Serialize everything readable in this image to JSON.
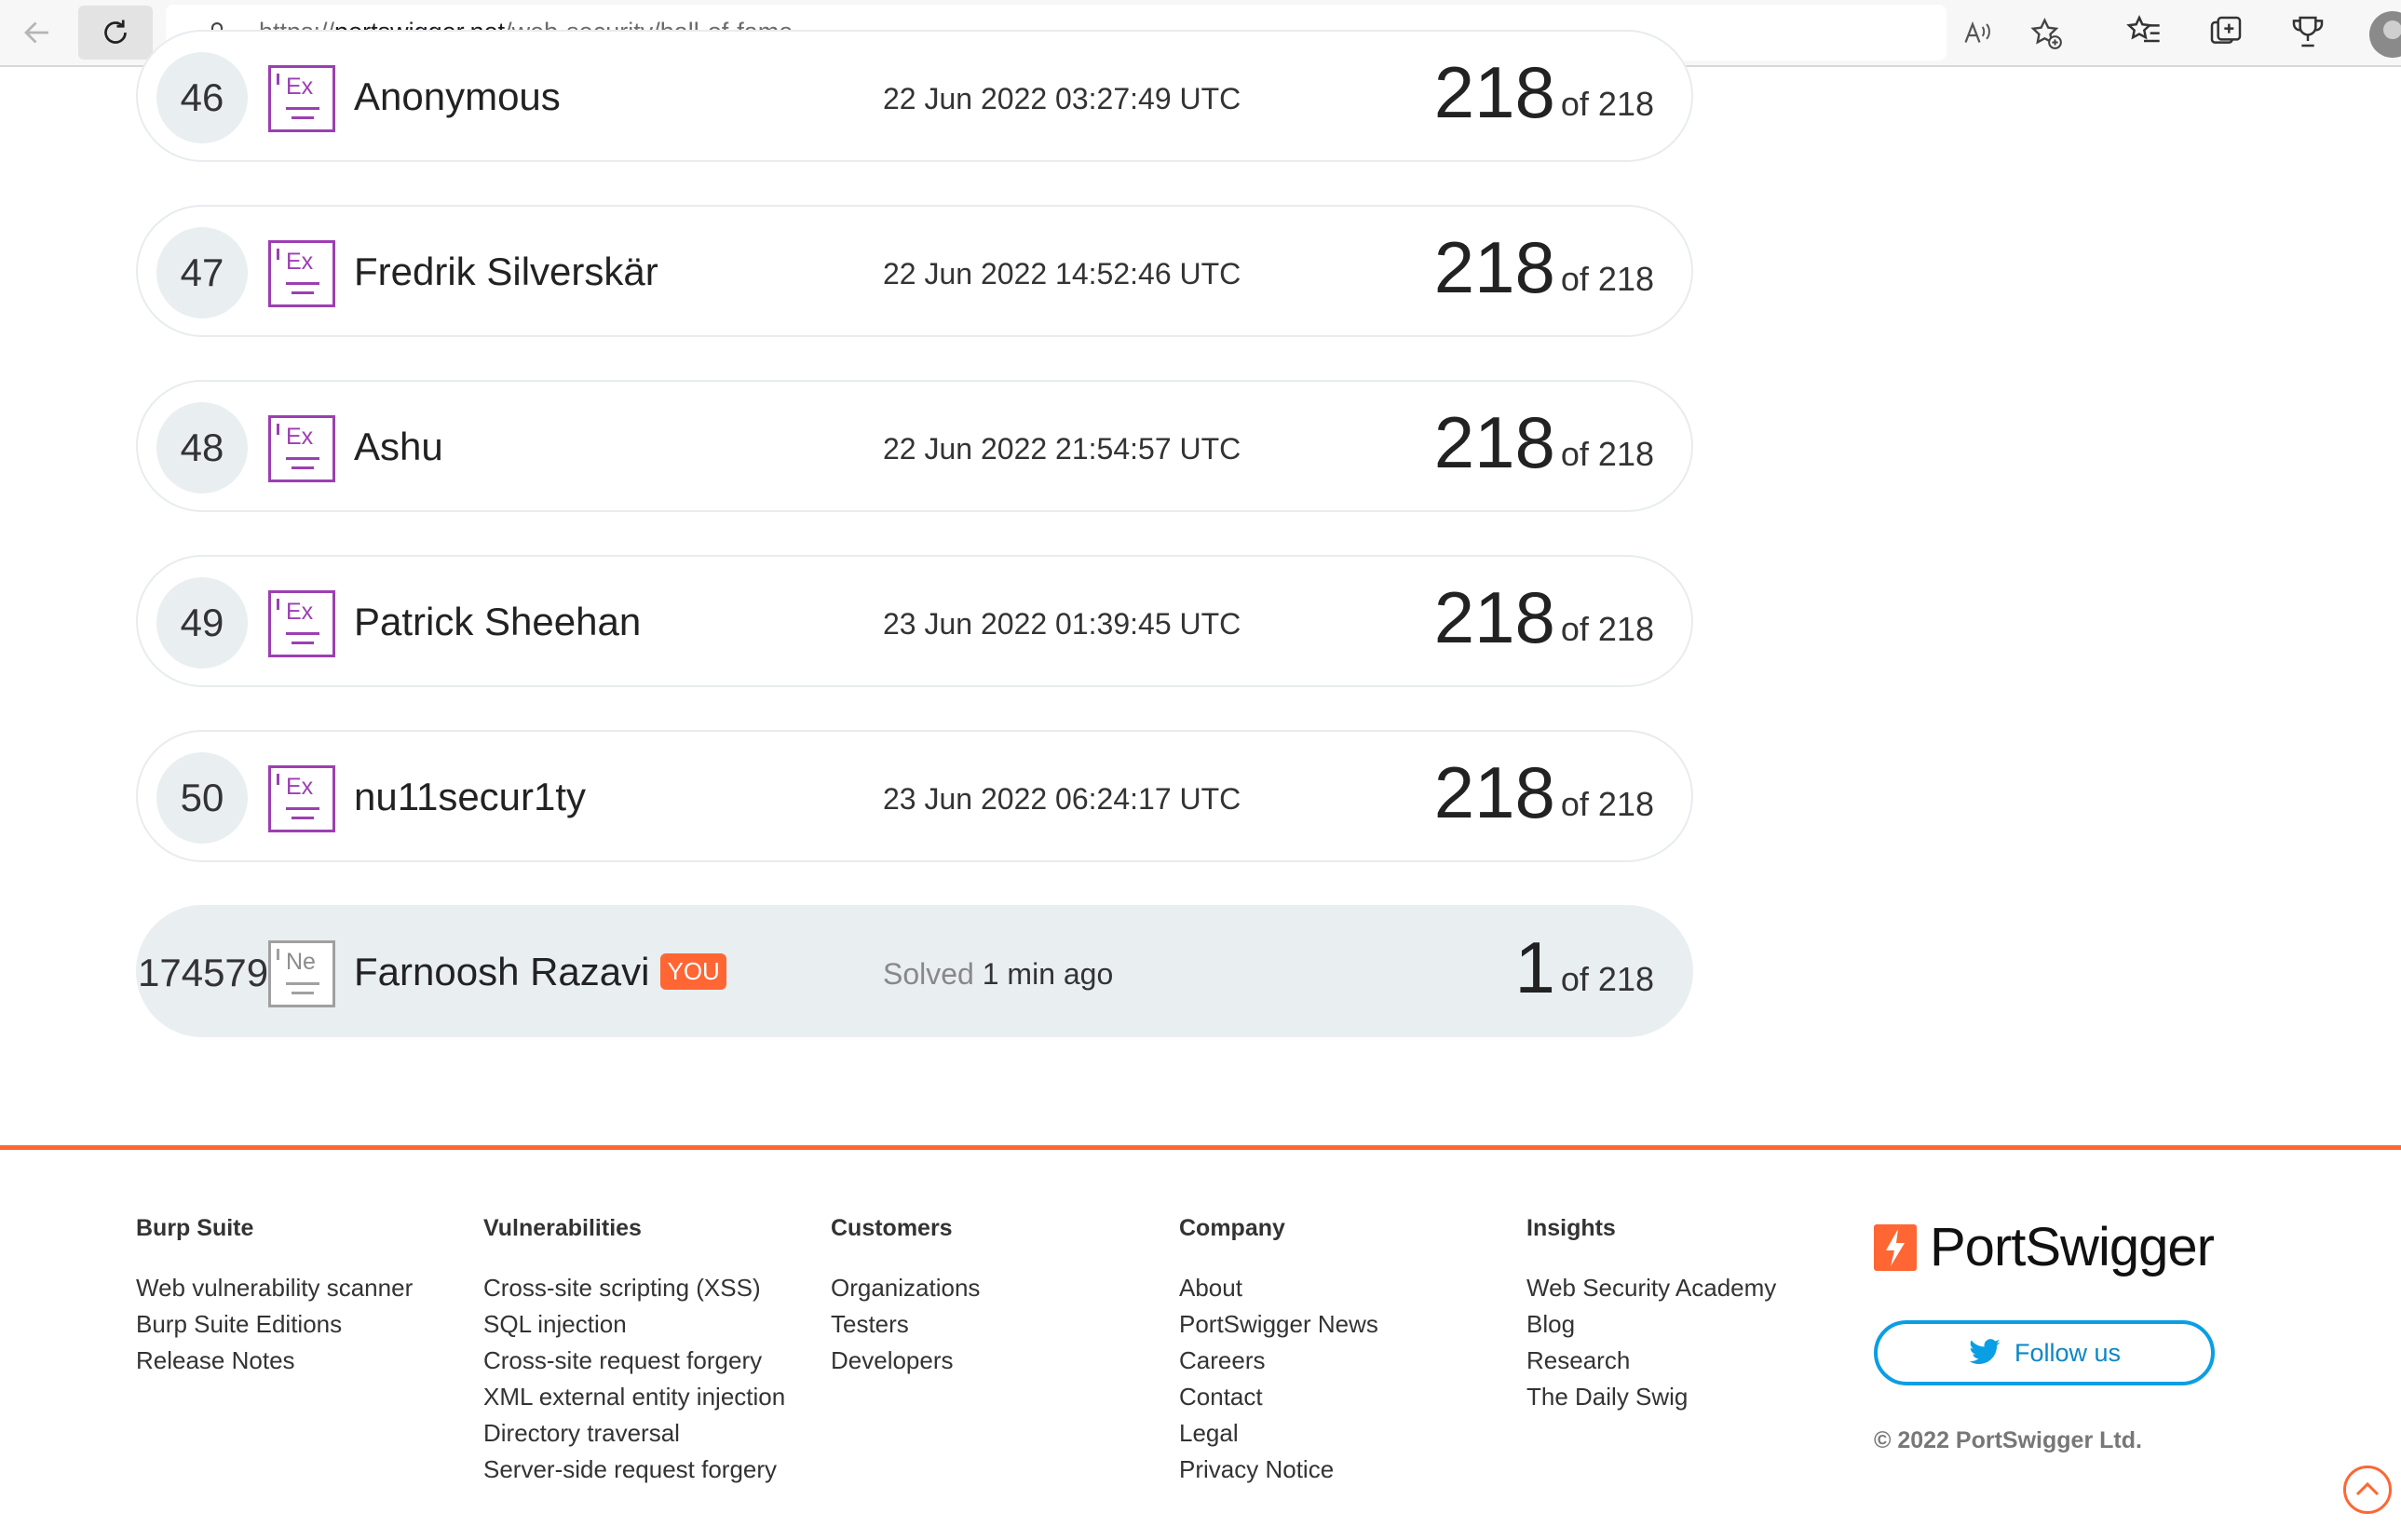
{
  "browser": {
    "url_prefix": "https://",
    "url_host": "portswigger.net",
    "url_path": "/web-security/hall-of-fame"
  },
  "leaderboard": [
    {
      "rank": "46",
      "badge": "Ex",
      "name": "Anonymous",
      "time": "22 Jun 2022 03:27:49 UTC",
      "score": "218",
      "of": "of 218"
    },
    {
      "rank": "47",
      "badge": "Ex",
      "name": "Fredrik Silverskär",
      "time": "22 Jun 2022 14:52:46 UTC",
      "score": "218",
      "of": "of 218"
    },
    {
      "rank": "48",
      "badge": "Ex",
      "name": "Ashu",
      "time": "22 Jun 2022 21:54:57 UTC",
      "score": "218",
      "of": "of 218"
    },
    {
      "rank": "49",
      "badge": "Ex",
      "name": "Patrick Sheehan",
      "time": "23 Jun 2022 01:39:45 UTC",
      "score": "218",
      "of": "of 218"
    },
    {
      "rank": "50",
      "badge": "Ex",
      "name": "nu11secur1ty",
      "time": "23 Jun 2022 06:24:17 UTC",
      "score": "218",
      "of": "of 218"
    }
  ],
  "current_user": {
    "rank": "174579",
    "badge": "Ne",
    "name": "Farnoosh Razavi",
    "tag": "YOU",
    "solved_label": "Solved",
    "solved_time": "1 min ago",
    "score": "1",
    "of": "of 218"
  },
  "footer": {
    "columns": [
      {
        "title": "Burp Suite",
        "links": [
          "Web vulnerability scanner",
          "Burp Suite Editions",
          "Release Notes"
        ]
      },
      {
        "title": "Vulnerabilities",
        "links": [
          "Cross-site scripting (XSS)",
          "SQL injection",
          "Cross-site request forgery",
          "XML external entity injection",
          "Directory traversal",
          "Server-side request forgery"
        ]
      },
      {
        "title": "Customers",
        "links": [
          "Organizations",
          "Testers",
          "Developers"
        ]
      },
      {
        "title": "Company",
        "links": [
          "About",
          "PortSwigger News",
          "Careers",
          "Contact",
          "Legal",
          "Privacy Notice"
        ]
      },
      {
        "title": "Insights",
        "links": [
          "Web Security Academy",
          "Blog",
          "Research",
          "The Daily Swig"
        ]
      }
    ],
    "logo_text": "PortSwigger",
    "follow_label": "Follow us",
    "copyright": "© 2022 PortSwigger Ltd."
  },
  "colors": {
    "accent": "#ff6633",
    "expert_badge": "#9c3fb3",
    "twitter": "#0a9ee4"
  }
}
